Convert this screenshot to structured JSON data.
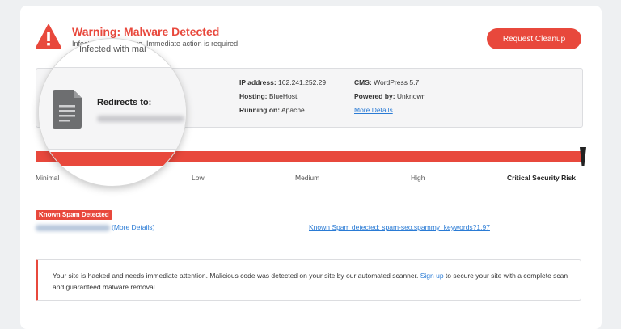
{
  "header": {
    "title": "Warning: Malware Detected",
    "subtitle": "Infected with malware. Immediate action is required",
    "cleanup_button": "Request Cleanup"
  },
  "site_info": {
    "redirects_label": "Redirects to:",
    "ip_label": "IP address:",
    "ip_value": "162.241.252.29",
    "hosting_label": "Hosting:",
    "hosting_value": "BlueHost",
    "running_label": "Running on:",
    "running_value": "Apache",
    "cms_label": "CMS:",
    "cms_value": "WordPress 5.7",
    "powered_label": "Powered by:",
    "powered_value": "Unknown",
    "more_details": "More Details"
  },
  "risk": {
    "labels": [
      "Minimal",
      "Low",
      "Medium",
      "High",
      "Critical Security Risk"
    ],
    "level": "Critical Security Risk",
    "fill_fraction": 1.0
  },
  "spam": {
    "badge": "Known Spam Detected",
    "more_details": "(More Details)",
    "keywords_link": "Known Spam detected: spam-seo.spammy_keywords?1.97"
  },
  "notice": {
    "text_before": "Your site is hacked and needs immediate attention. Malicious code was detected on your site by our automated scanner. ",
    "link": "Sign up",
    "text_after": " to secure your site with a complete scan and guaranteed malware removal."
  },
  "magnifier": {
    "top_text": "Infected with mal"
  },
  "colors": {
    "accent": "#e8483c",
    "link": "#2a7bd5",
    "background": "#eef0f2"
  },
  "icons": [
    "warning-icon",
    "document-icon",
    "risk-marker-icon"
  ]
}
